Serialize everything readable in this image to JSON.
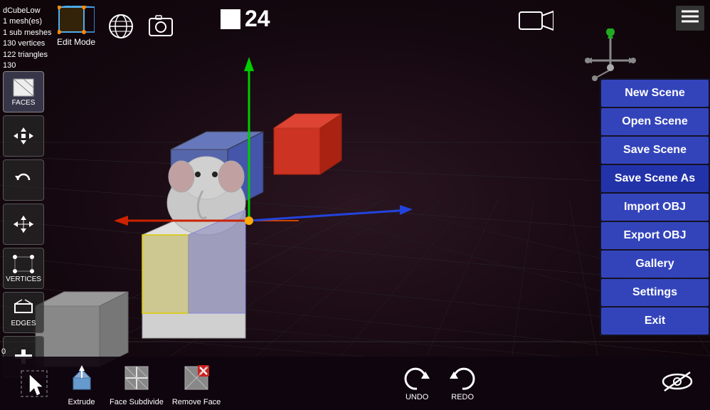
{
  "viewport": {
    "background": "#1a0a12"
  },
  "info": {
    "object_name": "dCubeLow",
    "mesh_count": "1 mesh(es)",
    "sub_mesh": "1 sub meshes",
    "vertices": "130 vertices",
    "triangles": "122 triangles",
    "line5": "130"
  },
  "top_toolbar": {
    "edit_mode_label": "Edit Mode",
    "frame_number": "24"
  },
  "nav_cube": {
    "label": "Navigation Cube"
  },
  "right_menu": {
    "buttons": [
      {
        "id": "new-scene",
        "label": "New Scene"
      },
      {
        "id": "open-scene",
        "label": "Open Scene"
      },
      {
        "id": "save-scene",
        "label": "Save Scene"
      },
      {
        "id": "save-scene-as",
        "label": "Save Scene As"
      },
      {
        "id": "import-obj",
        "label": "Import OBJ"
      },
      {
        "id": "export-obj",
        "label": "Export OBJ"
      },
      {
        "id": "gallery",
        "label": "Gallery"
      },
      {
        "id": "settings",
        "label": "Settings"
      },
      {
        "id": "exit",
        "label": "Exit"
      }
    ]
  },
  "left_sidebar": {
    "tools": [
      {
        "id": "faces",
        "label": "FACES",
        "active": true
      },
      {
        "id": "move",
        "label": "Move"
      },
      {
        "id": "undo-rotate",
        "label": "Rotate"
      },
      {
        "id": "scale",
        "label": "Scale"
      },
      {
        "id": "vertices",
        "label": "VERTICES"
      },
      {
        "id": "edges",
        "label": "EDGES"
      },
      {
        "id": "add",
        "label": "Add"
      }
    ]
  },
  "bottom_toolbar": {
    "tools": [
      {
        "id": "extrude",
        "label": "Extrude"
      },
      {
        "id": "face-subdivide",
        "label": "Face Subdivide"
      },
      {
        "id": "remove-face",
        "label": "Remove Face"
      }
    ],
    "undo_label": "UNDO",
    "redo_label": "REDO",
    "bottom_number": "0"
  },
  "colors": {
    "menu_bg": "#3344bb",
    "axis_green": "#00cc00",
    "axis_red": "#cc2200",
    "axis_blue": "#2244dd",
    "selection_yellow": "#ddcc00"
  }
}
